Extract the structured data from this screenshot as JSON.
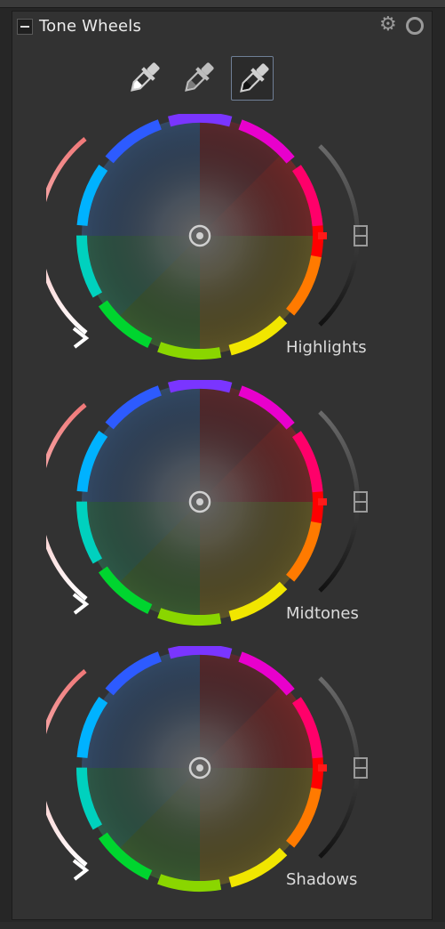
{
  "panel": {
    "title": "Tone Wheels",
    "icons": {
      "collapse": "minus-icon",
      "settings": "gear-icon",
      "toggle": "power-ring-icon"
    }
  },
  "eyedroppers": [
    {
      "name": "highlight-eyedropper-icon",
      "active": false
    },
    {
      "name": "midtone-eyedropper-icon",
      "active": false
    },
    {
      "name": "shadow-eyedropper-icon",
      "active": true
    }
  ],
  "wheels": [
    {
      "label": "Highlights"
    },
    {
      "label": "Midtones"
    },
    {
      "label": "Shadows"
    }
  ],
  "colors": {
    "panel_bg": "#323232",
    "left_slider_top": "#f07878",
    "left_slider_bottom": "#ffffff",
    "right_slider_top": "#6a6a6a",
    "right_slider_bottom": "#111111",
    "indicator": "#ff1a1a"
  }
}
